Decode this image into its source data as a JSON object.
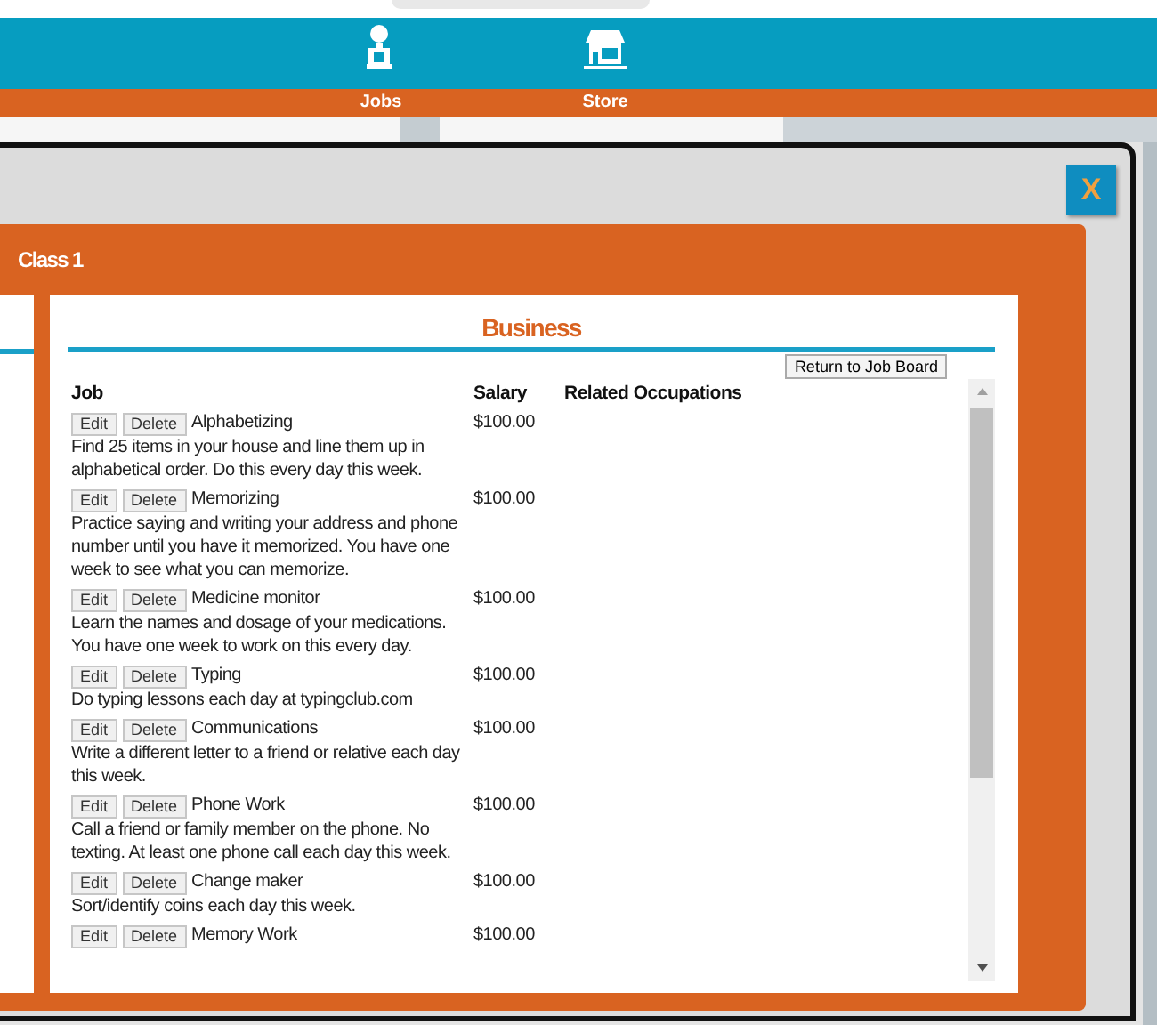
{
  "nav": {
    "items": [
      {
        "label": "Jobs",
        "kind": "worker"
      },
      {
        "label": "Store",
        "kind": "store"
      }
    ]
  },
  "dialog": {
    "close": "X",
    "title": "Class 1",
    "panel": {
      "heading": "Business",
      "return_button": "Return to Job Board",
      "columns": [
        "Job",
        "Salary",
        "Related Occupations"
      ],
      "rows": [
        {
          "edit": "Edit",
          "delete": "Delete",
          "name": "Alphabetizing",
          "description": "Find 25 items in your house and line them up in alphabetical order. Do this every day this week.",
          "salary": "$100.00"
        },
        {
          "edit": "Edit",
          "delete": "Delete",
          "name": "Memorizing",
          "description": "Practice saying and writing your address and phone number until you have it memorized. You have one week to see what you can memorize.",
          "salary": "$100.00"
        },
        {
          "edit": "Edit",
          "delete": "Delete",
          "name": "Medicine monitor",
          "description": "Learn the names and dosage of your medications. You have one week to work on this every day.",
          "salary": "$100.00"
        },
        {
          "edit": "Edit",
          "delete": "Delete",
          "name": "Typing",
          "description": "Do typing lessons each day at typingclub.com",
          "salary": "$100.00"
        },
        {
          "edit": "Edit",
          "delete": "Delete",
          "name": "Communications",
          "description": "Write a different letter to a friend or relative each day this week.",
          "salary": "$100.00"
        },
        {
          "edit": "Edit",
          "delete": "Delete",
          "name": "Phone Work",
          "description": "Call a friend or family member on the phone. No texting. At least one phone call each day this week.",
          "salary": "$100.00"
        },
        {
          "edit": "Edit",
          "delete": "Delete",
          "name": "Change maker",
          "description": "Sort/identify coins each day this week.",
          "salary": "$100.00"
        },
        {
          "edit": "Edit",
          "delete": "Delete",
          "name": "Memory Work",
          "salary": "$100.00"
        }
      ]
    }
  }
}
